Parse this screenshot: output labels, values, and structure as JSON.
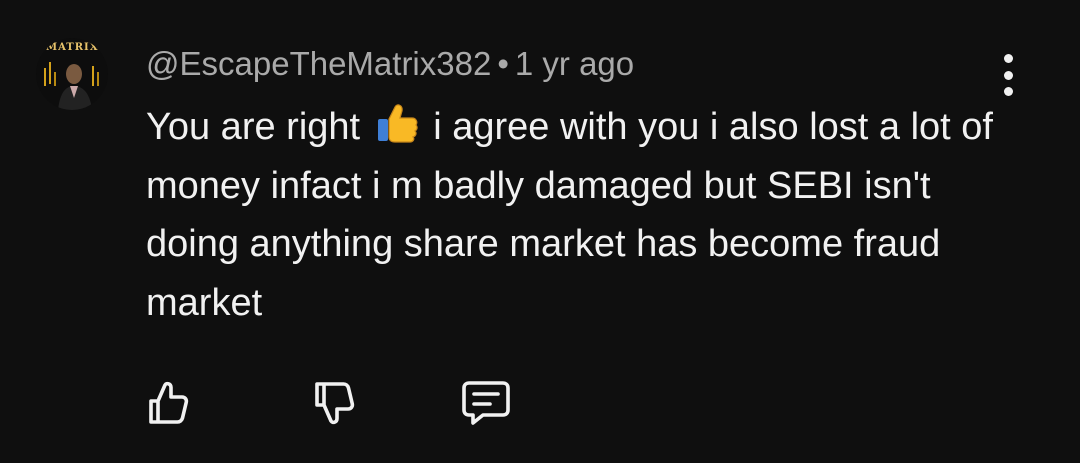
{
  "comment": {
    "avatar_icon": "channel-avatar",
    "avatar_logo_text": "MATRIX",
    "author": "@EscapeTheMatrix382",
    "separator": "•",
    "timestamp": "1 yr ago",
    "text_before_emoji": "You are right",
    "emoji": "thumbs-up",
    "text_after_emoji": "i agree with you i also lost a lot of money infact i m badly damaged but SEBI isn't doing anything share market has become fraud market",
    "menu_icon": "more-vert-icon"
  },
  "actions": {
    "like_icon": "thumbs-up-icon",
    "dislike_icon": "thumbs-down-icon",
    "reply_icon": "reply-icon"
  },
  "colors": {
    "background": "#0f0f0f",
    "primary_text": "#f1f1f1",
    "secondary_text": "#aaaaaa",
    "emoji_yellow": "#f9b925"
  }
}
